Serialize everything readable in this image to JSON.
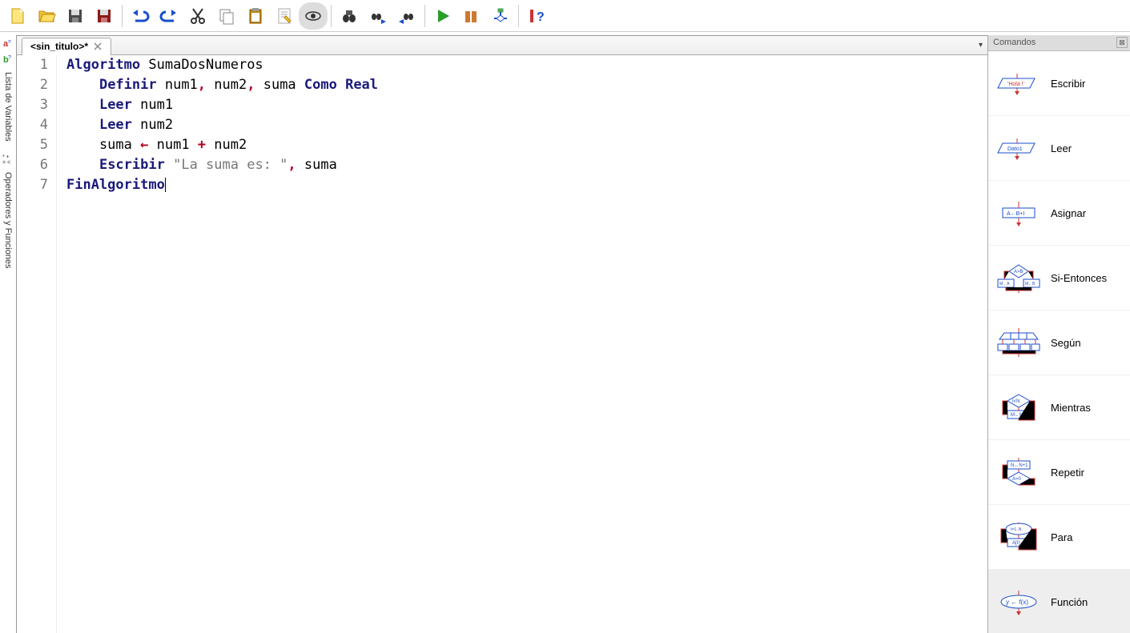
{
  "toolbar": {
    "buttons": [
      "new",
      "open",
      "save",
      "save-as",
      "undo",
      "redo",
      "cut",
      "copy",
      "paste",
      "edit",
      "view",
      "find",
      "find-next",
      "find-prev",
      "run",
      "step",
      "debug",
      "help"
    ]
  },
  "tab": {
    "title": "<sin_titulo>*"
  },
  "left_side": {
    "label1": "Lista de Variables",
    "label2": "Operadores y Funciones"
  },
  "code": {
    "lines": [
      {
        "n": 1,
        "tokens": [
          {
            "t": "Algoritmo",
            "c": "kw"
          },
          {
            "t": " ",
            "c": "txt"
          },
          {
            "t": "SumaDosNumeros",
            "c": "txt"
          }
        ]
      },
      {
        "n": 2,
        "tokens": [
          {
            "t": "    ",
            "c": "txt"
          },
          {
            "t": "Definir",
            "c": "kw"
          },
          {
            "t": " num1",
            "c": "txt"
          },
          {
            "t": ",",
            "c": "op"
          },
          {
            "t": " num2",
            "c": "txt"
          },
          {
            "t": ",",
            "c": "op"
          },
          {
            "t": " suma ",
            "c": "txt"
          },
          {
            "t": "Como Real",
            "c": "kw"
          }
        ]
      },
      {
        "n": 3,
        "tokens": [
          {
            "t": "    ",
            "c": "txt"
          },
          {
            "t": "Leer",
            "c": "kw"
          },
          {
            "t": " num1",
            "c": "txt"
          }
        ]
      },
      {
        "n": 4,
        "tokens": [
          {
            "t": "    ",
            "c": "txt"
          },
          {
            "t": "Leer",
            "c": "kw"
          },
          {
            "t": " num2",
            "c": "txt"
          }
        ]
      },
      {
        "n": 5,
        "tokens": [
          {
            "t": "    suma ",
            "c": "txt"
          },
          {
            "t": "←",
            "c": "op"
          },
          {
            "t": " num1 ",
            "c": "txt"
          },
          {
            "t": "+",
            "c": "op"
          },
          {
            "t": " num2",
            "c": "txt"
          }
        ]
      },
      {
        "n": 6,
        "tokens": [
          {
            "t": "    ",
            "c": "txt"
          },
          {
            "t": "Escribir",
            "c": "kw"
          },
          {
            "t": " ",
            "c": "txt"
          },
          {
            "t": "\"La suma es: \"",
            "c": "str"
          },
          {
            "t": ",",
            "c": "op"
          },
          {
            "t": " suma",
            "c": "txt"
          }
        ]
      },
      {
        "n": 7,
        "tokens": [
          {
            "t": "FinAlgoritmo",
            "c": "kw"
          }
        ]
      }
    ]
  },
  "commands": {
    "title": "Comandos",
    "items": [
      {
        "label": "Escribir",
        "icon": "escribir"
      },
      {
        "label": "Leer",
        "icon": "leer"
      },
      {
        "label": "Asignar",
        "icon": "asignar"
      },
      {
        "label": "Si-Entonces",
        "icon": "si"
      },
      {
        "label": "Según",
        "icon": "segun"
      },
      {
        "label": "Mientras",
        "icon": "mientras"
      },
      {
        "label": "Repetir",
        "icon": "repetir"
      },
      {
        "label": "Para",
        "icon": "para"
      },
      {
        "label": "Función",
        "icon": "funcion",
        "selected": true
      }
    ]
  }
}
